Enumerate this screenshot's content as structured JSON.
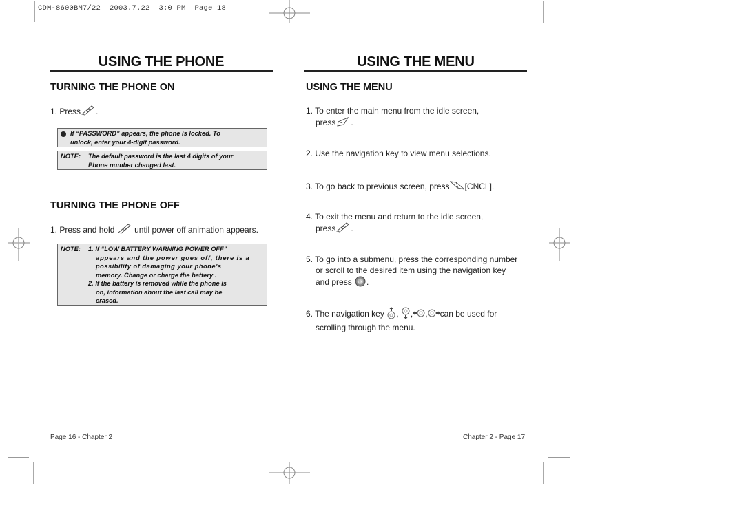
{
  "print_slug": "CDM-8600BM7/22  2003.7.22  3:0 PM  Page 18",
  "left_page": {
    "title": "USING THE PHONE",
    "sections": [
      {
        "heading": "TURNING THE PHONE ON",
        "steps": [
          {
            "prefix": "1. Press",
            "icon": "end-power-key-icon",
            "suffix": "."
          }
        ],
        "bullet_note": {
          "line1": "If “PASSWORD” appears, the phone is locked. To",
          "line2": "unlock, enter your 4-digit password."
        },
        "note": {
          "label": "NOTE:",
          "line1": "The default password is the last 4 digits of your",
          "line2": "Phone number changed last."
        }
      },
      {
        "heading": "TURNING THE PHONE OFF",
        "steps": [
          {
            "prefix": "1. Press and hold",
            "icon": "end-power-key-icon",
            "suffix": "until power off animation appears."
          }
        ],
        "note": {
          "label": "NOTE:",
          "item1_line1": "1. If “LOW BATTERY WARNING POWER OFF”",
          "item1_line2": "appears and the power goes off, there is a",
          "item1_line3": "possibility of damaging your phone’s",
          "item1_line4": "memory. Change or charge the battery .",
          "item2_line1": "2. If the battery is removed while the phone is",
          "item2_line2": "on, information about the last call may be",
          "item2_line3": "erased."
        }
      }
    ],
    "footer": "Page 16 - Chapter 2"
  },
  "right_page": {
    "title": "USING THE MENU",
    "heading": "USING THE MENU",
    "steps": [
      {
        "line1": "1. To enter the main menu from the idle screen,",
        "line2_prefix": "press",
        "icon": "menu-softkey-icon",
        "line2_suffix": "."
      },
      {
        "line1": "2. Use the navigation key to view menu selections."
      },
      {
        "line1_prefix": "3. To go back to previous screen, press",
        "icon": "cancel-softkey-icon",
        "line1_suffix": "[CNCL]."
      },
      {
        "line1": "4. To exit the menu and return to the idle screen,",
        "line2_prefix": "press",
        "icon": "end-power-key-icon",
        "line2_suffix": "."
      },
      {
        "line1": "5. To go into a submenu, press the corresponding number",
        "line2": "or scroll to the desired item using the navigation key",
        "line3_prefix": "and press",
        "icon": "ok-key-icon",
        "line3_suffix": "."
      },
      {
        "line1_prefix": "6. The navigation key",
        "sep": ",",
        "line1_suffix": "can be used for",
        "line2": "scrolling through the menu."
      }
    ],
    "footer": "Chapter 2 - Page 17"
  }
}
